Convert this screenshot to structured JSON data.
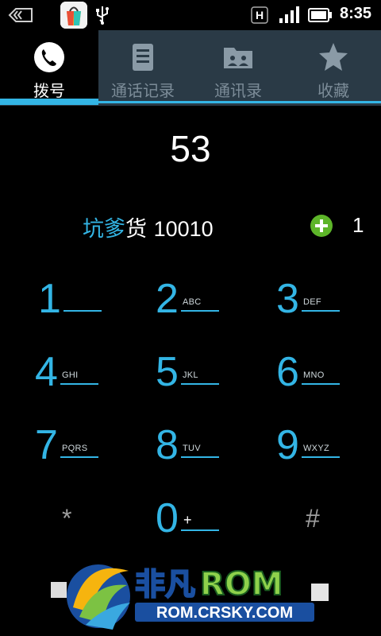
{
  "status_bar": {
    "time": "8:35",
    "network_badge": "H",
    "icons": [
      "back-arrow-icon",
      "app-store-icon",
      "usb-icon",
      "network-h-icon",
      "signal-icon",
      "battery-icon"
    ]
  },
  "tabs": [
    {
      "label": "拨号",
      "icon": "phone-icon",
      "active": true
    },
    {
      "label": "通话记录",
      "icon": "call-log-icon",
      "active": false
    },
    {
      "label": "通讯录",
      "icon": "contacts-icon",
      "active": false
    },
    {
      "label": "收藏",
      "icon": "star-icon",
      "active": false
    }
  ],
  "dialer": {
    "digits": "53",
    "suggestion": {
      "name_highlight": "坑爹",
      "name_rest": "货",
      "number": "10010"
    },
    "match_count": "1"
  },
  "keypad": [
    {
      "num": "1",
      "letters": ""
    },
    {
      "num": "2",
      "letters": "ABC"
    },
    {
      "num": "3",
      "letters": "DEF"
    },
    {
      "num": "4",
      "letters": "GHI"
    },
    {
      "num": "5",
      "letters": "JKL"
    },
    {
      "num": "6",
      "letters": "MNO"
    },
    {
      "num": "7",
      "letters": "PQRS"
    },
    {
      "num": "8",
      "letters": "TUV"
    },
    {
      "num": "9",
      "letters": "WXYZ"
    },
    {
      "num": "*",
      "letters": ""
    },
    {
      "num": "0",
      "letters": "+"
    },
    {
      "num": "#",
      "letters": ""
    }
  ],
  "watermark": {
    "brand_cn": "非凡",
    "brand_en": "ROM",
    "url": "ROM.CRSKY.COM"
  },
  "colors": {
    "accent": "#33b5e5",
    "tab_bg": "#2a3a46",
    "add_green": "#5db529"
  }
}
